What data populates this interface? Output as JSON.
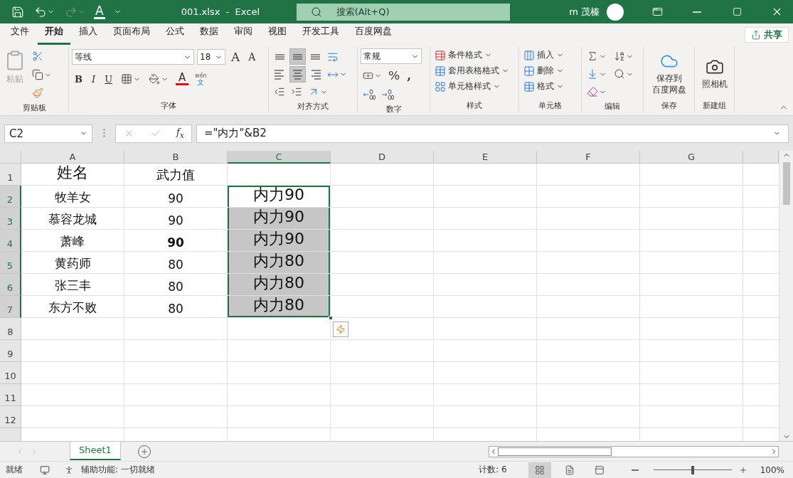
{
  "quick_access": {
    "redo": {
      "disabled": true
    },
    "font_color": "A"
  },
  "title_bar": {
    "title": "001.xlsx  -  Excel",
    "search": {
      "placeholder": "搜索(Alt+Q)"
    },
    "user": "m 茂榛"
  },
  "ribbon_tabs": [
    {
      "label": "文件",
      "selected": false
    },
    {
      "label": "开始",
      "selected": true
    },
    {
      "label": "插入",
      "selected": false
    },
    {
      "label": "页面布局",
      "selected": false
    },
    {
      "label": "公式",
      "selected": false
    },
    {
      "label": "数据",
      "selected": false
    },
    {
      "label": "审阅",
      "selected": false
    },
    {
      "label": "视图",
      "selected": false
    },
    {
      "label": "开发工具",
      "selected": false
    },
    {
      "label": "百度网盘",
      "selected": false
    }
  ],
  "share_button": "共享",
  "ribbon": {
    "clipboard": {
      "label": "剪贴板",
      "paste": {
        "text": "粘贴",
        "disabled": true
      }
    },
    "font": {
      "label": "字体",
      "font_name": "等线",
      "font_size": "18",
      "grow": "A",
      "shrink": "A",
      "bold": "B",
      "italic": "I",
      "underline": "U",
      "font_color": "A",
      "phonetic_top": "wén",
      "phonetic_bottom": "文"
    },
    "alignment": {
      "label": "对齐方式",
      "vertical": [
        {
          "selected": false
        },
        {
          "selected": true
        },
        {
          "selected": false
        }
      ],
      "horizontal": [
        {
          "selected": false
        },
        {
          "selected": true
        },
        {
          "selected": false
        }
      ]
    },
    "number": {
      "label": "数字",
      "format": "常规",
      "percent": "%",
      "comma": ","
    },
    "styles": {
      "label": "样式",
      "items": [
        "条件格式",
        "套用表格格式",
        "单元格样式"
      ]
    },
    "cells": {
      "label": "单元格",
      "items": [
        "插入",
        "删除",
        "格式"
      ]
    },
    "editing": {
      "label": "编辑"
    },
    "save": {
      "label": "保存",
      "button": [
        "保存到",
        "百度网盘"
      ]
    },
    "new_group": {
      "label": "新建组",
      "button": "照相机"
    }
  },
  "formula_bar": {
    "name_box": "C2",
    "function_button": "f$_{x}$",
    "formula": "=\"内力\"&B2"
  },
  "grid": {
    "columns": [
      {
        "label": "A",
        "selected": false
      },
      {
        "label": "B",
        "selected": false
      },
      {
        "label": "C",
        "selected": true
      },
      {
        "label": "D",
        "selected": false
      },
      {
        "label": "E",
        "selected": false
      },
      {
        "label": "F",
        "selected": false
      },
      {
        "label": "G",
        "selected": false
      }
    ],
    "rows": [
      {
        "label": "1",
        "selected": false,
        "cells": [
          {
            "text": "姓名",
            "selected": false
          },
          {
            "text": "武力值",
            "selected": false
          }
        ]
      },
      {
        "label": "2",
        "selected": true,
        "cells": [
          {
            "text": "牧羊女",
            "selected": false
          },
          {
            "text": "90",
            "selected": false
          },
          {
            "text": "内力90",
            "selected": true,
            "active": true
          }
        ]
      },
      {
        "label": "3",
        "selected": true,
        "cells": [
          {
            "text": "慕容龙城",
            "selected": false
          },
          {
            "text": "90",
            "selected": false
          },
          {
            "text": "内力90",
            "selected": true
          }
        ]
      },
      {
        "label": "4",
        "selected": true,
        "cells": [
          {
            "text": "萧峰",
            "selected": false
          },
          {
            "text": "90",
            "selected": false,
            "bold": true
          },
          {
            "text": "内力90",
            "selected": true
          }
        ]
      },
      {
        "label": "5",
        "selected": true,
        "cells": [
          {
            "text": "黄药师",
            "selected": false
          },
          {
            "text": "80",
            "selected": false
          },
          {
            "text": "内力80",
            "selected": true
          }
        ]
      },
      {
        "label": "6",
        "selected": true,
        "cells": [
          {
            "text": "张三丰",
            "selected": false
          },
          {
            "text": "80",
            "selected": false
          },
          {
            "text": "内力80",
            "selected": true
          }
        ]
      },
      {
        "label": "7",
        "selected": true,
        "cells": [
          {
            "text": "东方不败",
            "selected": false
          },
          {
            "text": "80",
            "selected": false
          },
          {
            "text": "内力80",
            "selected": true
          }
        ]
      },
      {
        "label": "8",
        "selected": false
      },
      {
        "label": "9",
        "selected": false
      },
      {
        "label": "10",
        "selected": false
      },
      {
        "label": "11",
        "selected": false
      },
      {
        "label": "12",
        "selected": false
      }
    ]
  },
  "sheet_tabs": [
    {
      "label": "Sheet1",
      "selected": true
    }
  ],
  "status_bar": {
    "ready": "就绪",
    "accessibility": "辅助功能: 一切就绪",
    "count": "计数: 6",
    "views": [
      {
        "selected": true
      },
      {
        "selected": false
      },
      {
        "selected": false
      }
    ],
    "zoom": {
      "level": 0.5,
      "reading": "100%"
    }
  }
}
